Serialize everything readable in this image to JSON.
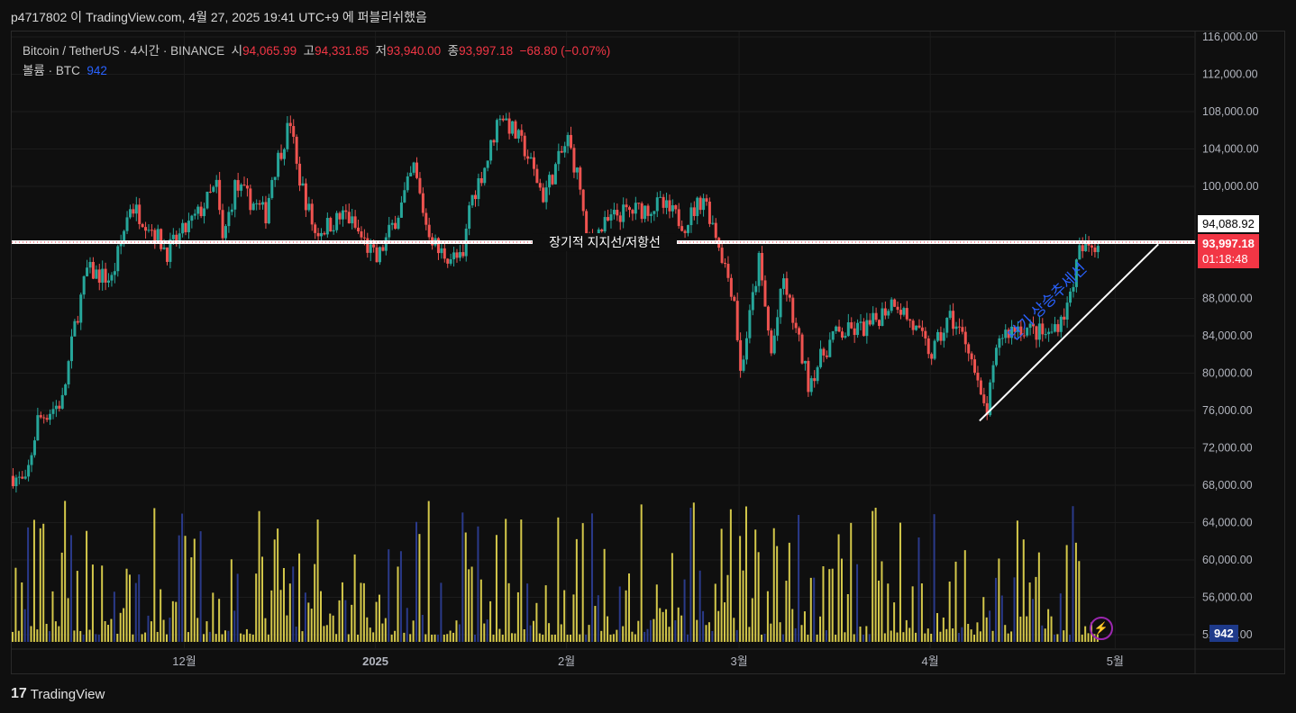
{
  "header": {
    "publish_info": "p4717802 이 TradingView.com, 4월 27, 2025 19:41 UTC+9 에 퍼블리쉬했음"
  },
  "legend": {
    "symbol": "Bitcoin / TetherUS · 4시간 · BINANCE",
    "open_label": "시",
    "open": "94,065.99",
    "high_label": "고",
    "high": "94,331.85",
    "low_label": "저",
    "low": "93,940.00",
    "close_label": "종",
    "close": "93,997.18",
    "change": "−68.80 (−0.07%)",
    "volume_label": "볼륨 · BTC",
    "volume": "942"
  },
  "price_tags": {
    "high_marker": "94,088.92",
    "last_price": "93,997.18",
    "countdown": "01:18:48",
    "volume": "942"
  },
  "annotations": {
    "support_line_label": "장기적 지지선/저항선",
    "support_price": 94020,
    "trend_label": "단기 상승추세선",
    "trend_start": [
      157,
      74900
    ],
    "trend_end": [
      186,
      93800
    ]
  },
  "footer": {
    "brand": "TradingView"
  },
  "colors": {
    "up": "#26a69a",
    "down": "#ef5350",
    "volume": "#d4c84a",
    "volume_alt": "#2a3a8a",
    "tag_red": "#f23645"
  },
  "chart_data": {
    "type": "candlestick",
    "ylim": [
      50000,
      117000
    ],
    "y_ticks": [
      "116,000.00",
      "112,000.00",
      "108,000.00",
      "104,000.00",
      "100,000.00",
      "88,000.00",
      "84,000.00",
      "80,000.00",
      "76,000.00",
      "72,000.00",
      "68,000.00",
      "64,000.00",
      "60,000.00",
      "56,000.00",
      "52,000.00"
    ],
    "y_tick_values": [
      116000,
      112000,
      108000,
      104000,
      100000,
      88000,
      84000,
      80000,
      76000,
      72000,
      68000,
      64000,
      60000,
      56000,
      52000
    ],
    "x_ticks": [
      {
        "label": "12월",
        "day": 28
      },
      {
        "label": "2025",
        "day": 59
      },
      {
        "label": "2월",
        "day": 90
      },
      {
        "label": "3월",
        "day": 118
      },
      {
        "label": "4월",
        "day": 149
      },
      {
        "label": "5월",
        "day": 179
      }
    ],
    "x_range_days": [
      0,
      192
    ],
    "price_path": [
      [
        0,
        69000
      ],
      [
        2,
        68000
      ],
      [
        4,
        75000
      ],
      [
        8,
        77000
      ],
      [
        10,
        85000
      ],
      [
        12,
        91000
      ],
      [
        16,
        90000
      ],
      [
        19,
        98000
      ],
      [
        22,
        96000
      ],
      [
        25,
        93000
      ],
      [
        30,
        97000
      ],
      [
        33,
        100000
      ],
      [
        34,
        94000
      ],
      [
        36,
        100000
      ],
      [
        41,
        97000
      ],
      [
        42,
        101000
      ],
      [
        45,
        107000
      ],
      [
        46,
        102000
      ],
      [
        49,
        95000
      ],
      [
        54,
        97000
      ],
      [
        57,
        94000
      ],
      [
        59,
        92000
      ],
      [
        63,
        98000
      ],
      [
        65,
        102000
      ],
      [
        67,
        96000
      ],
      [
        69,
        93000
      ],
      [
        73,
        92000
      ],
      [
        74,
        98000
      ],
      [
        77,
        103000
      ],
      [
        79,
        108000
      ],
      [
        83,
        104000
      ],
      [
        86,
        99000
      ],
      [
        90,
        105000
      ],
      [
        92,
        100000
      ],
      [
        93,
        94000
      ],
      [
        98,
        97000
      ],
      [
        105,
        98000
      ],
      [
        109,
        96000
      ],
      [
        112,
        99000
      ],
      [
        114,
        95000
      ],
      [
        117,
        88000
      ],
      [
        118,
        80000
      ],
      [
        121,
        92000
      ],
      [
        123,
        82000
      ],
      [
        125,
        90000
      ],
      [
        129,
        79000
      ],
      [
        133,
        84000
      ],
      [
        139,
        85000
      ],
      [
        143,
        88000
      ],
      [
        149,
        82000
      ],
      [
        152,
        86000
      ],
      [
        155,
        83000
      ],
      [
        157,
        77000
      ],
      [
        158,
        76000
      ],
      [
        160,
        84000
      ],
      [
        163,
        85000
      ],
      [
        168,
        84000
      ],
      [
        171,
        87000
      ],
      [
        173,
        93000
      ],
      [
        176,
        94000
      ]
    ]
  }
}
